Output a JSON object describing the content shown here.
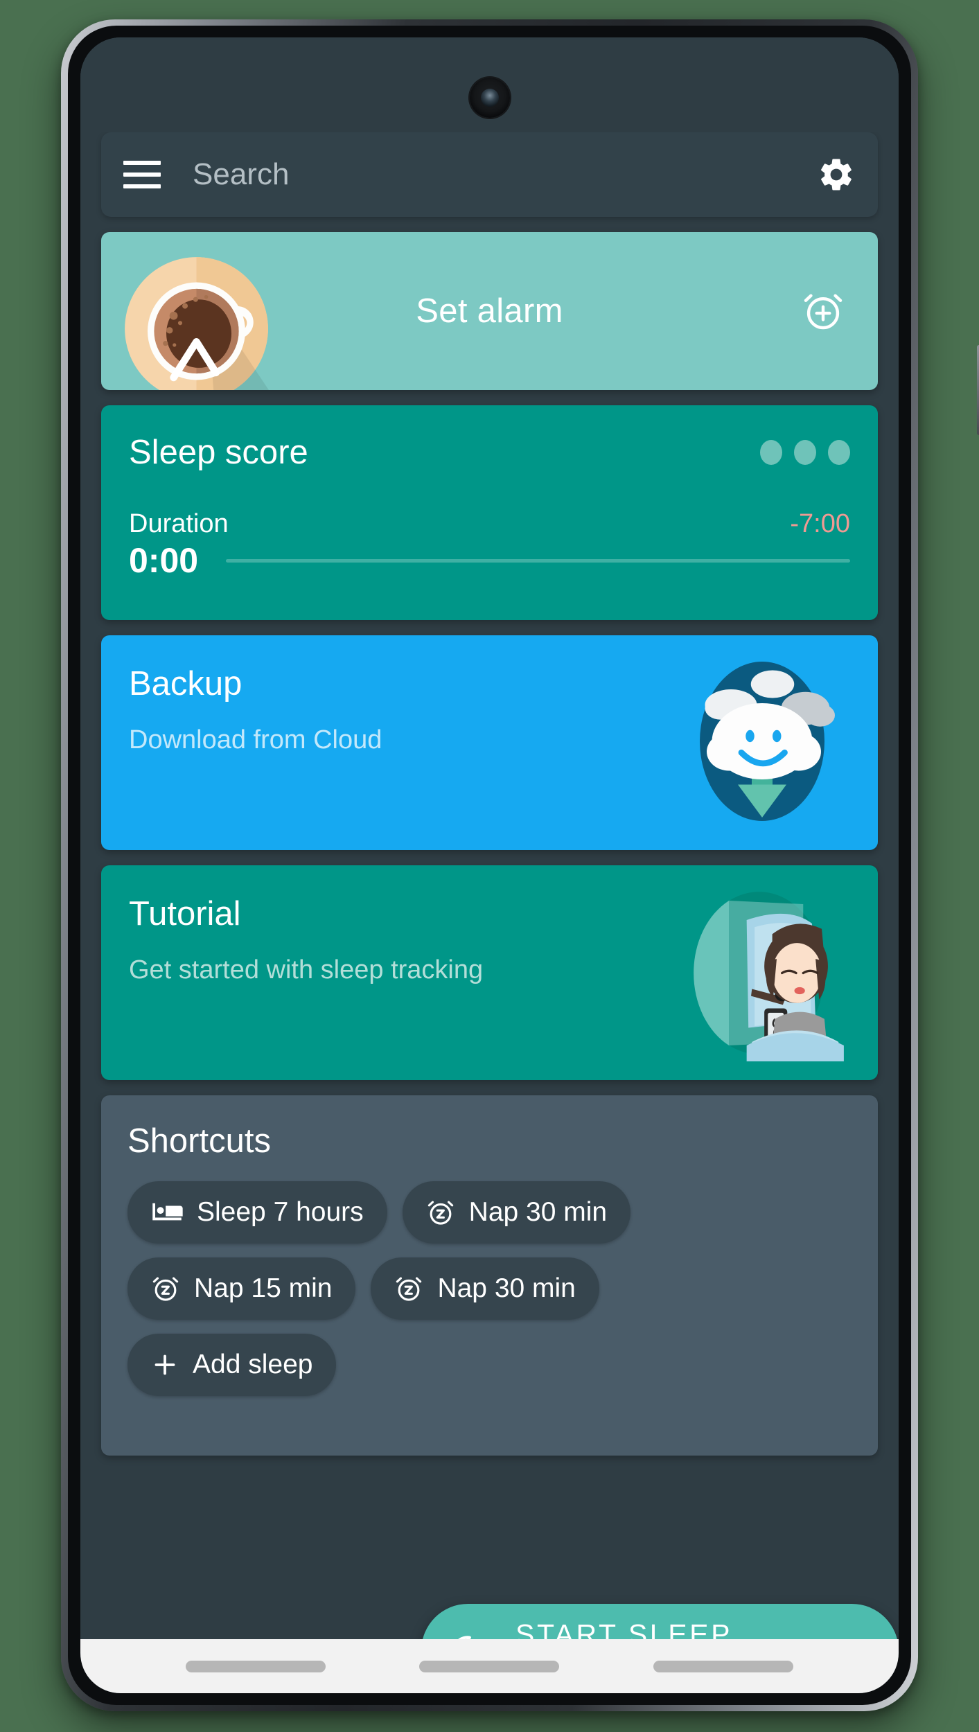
{
  "colors": {
    "page_background": "#4a7050",
    "app_background": "#2f3d44",
    "toolbar": "#32424a",
    "set_alarm_card": "#7dc9c3",
    "sleep_score_card": "#009688",
    "backup_card": "#16a9f1",
    "tutorial_card": "#009688",
    "shortcuts_panel": "#4a5c69",
    "chip": "#36454e",
    "fab": "#4dbcae",
    "duration_delta": "#ef9a93",
    "nav_bar": "#f2f2f2"
  },
  "toolbar": {
    "menu_icon": "hamburger-menu-icon",
    "search_placeholder": "Search",
    "search_value": "",
    "settings_icon": "gear-icon"
  },
  "cards": {
    "set_alarm": {
      "label": "Set alarm",
      "illustration": "coffee-cup-illustration",
      "action_icon": "alarm-add-icon"
    },
    "sleep_score": {
      "title": "Sleep score",
      "overflow_icon": "three-dots-icon",
      "duration_label": "Duration",
      "duration_delta": "-7:00",
      "duration_value": "0:00",
      "progress_percent": 0
    },
    "backup": {
      "title": "Backup",
      "subtitle": "Download from Cloud",
      "illustration": "smiling-cloud-download-illustration"
    },
    "tutorial": {
      "title": "Tutorial",
      "subtitle": "Get started with sleep tracking",
      "illustration": "sleeping-woman-illustration"
    }
  },
  "shortcuts": {
    "title": "Shortcuts",
    "chips": [
      {
        "label": "Sleep 7 hours",
        "icon": "bed-icon"
      },
      {
        "label": "Nap 30 min",
        "icon": "alarm-snooze-icon"
      },
      {
        "label": "Nap 15 min",
        "icon": "alarm-snooze-icon"
      },
      {
        "label": "Nap 30 min",
        "icon": "alarm-snooze-icon"
      },
      {
        "label": "Add sleep",
        "icon": "plus-icon"
      }
    ]
  },
  "fab": {
    "label": "START SLEEP TRACKING",
    "icon": "crescent-moon-icon"
  },
  "nav_bar": {
    "buttons": [
      "recents-button",
      "home-button",
      "back-button"
    ]
  }
}
